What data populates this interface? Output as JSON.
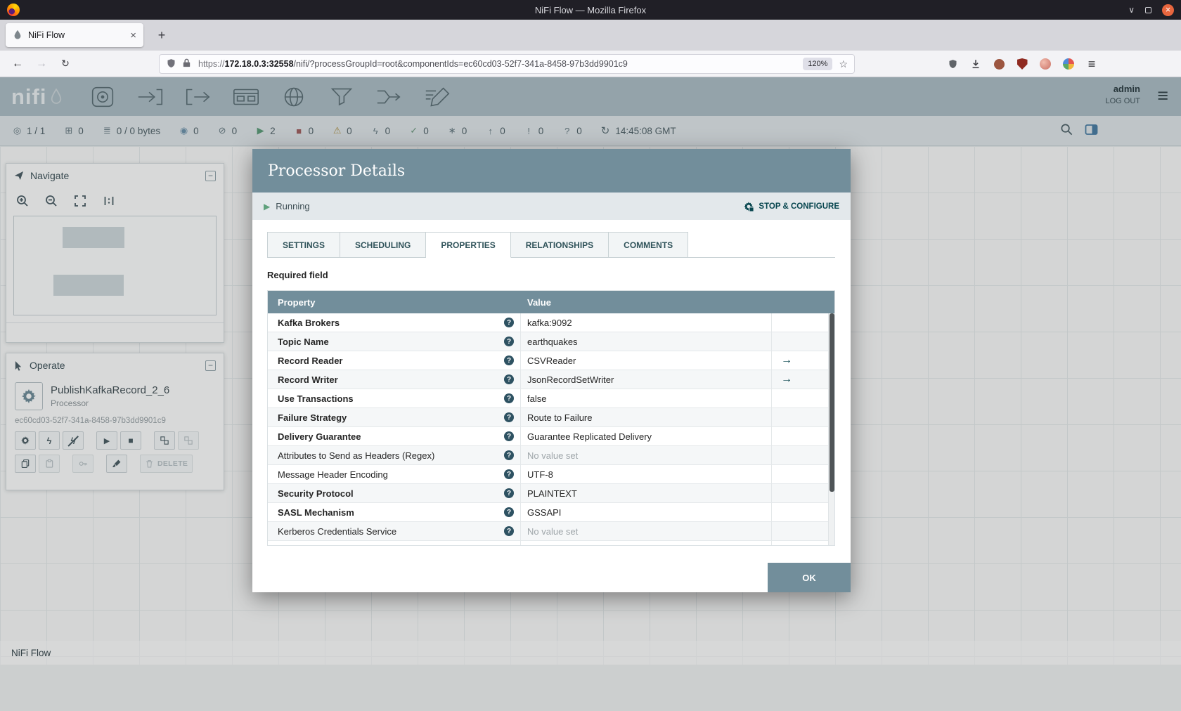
{
  "theme": {
    "dialog_header_bg": "#728e9b",
    "accent_dark_teal": "#004849",
    "status_strip_bg": "#e3e8eb",
    "running_green": "#5fa17c",
    "nifi_header_bg": "#adbec6",
    "ok_button_bg": "#728e9b"
  },
  "browser": {
    "window_title": "NiFi Flow — Mozilla Firefox",
    "tab": {
      "title": "NiFi Flow"
    },
    "url": {
      "protocol": "https://",
      "host": "172.18.0.3:32558",
      "path": "/nifi/?processGroupId=root&componentIds=ec60cd03-52f7-341a-8458-97b3dd9901c9"
    },
    "zoom_indicator": "120%"
  },
  "nifi": {
    "header": {
      "logo": "nifi",
      "user": "admin",
      "logout": "LOG OUT",
      "palette": [
        {
          "name": "processor"
        },
        {
          "name": "input-port"
        },
        {
          "name": "output-port"
        },
        {
          "name": "process-group"
        },
        {
          "name": "remote-process-group"
        },
        {
          "name": "funnel"
        },
        {
          "name": "template"
        },
        {
          "name": "label"
        }
      ]
    },
    "statusbar": {
      "items": [
        {
          "name": "clustered",
          "glyph": "◎",
          "count": "1 / 1"
        },
        {
          "name": "active-threads",
          "glyph": "⊞",
          "count": "0"
        },
        {
          "name": "queued",
          "glyph": "≣",
          "count": "0 / 0 bytes"
        },
        {
          "name": "transmitting",
          "glyph": "◉",
          "count": "0"
        },
        {
          "name": "not-transmitting",
          "glyph": "⊘",
          "count": "0"
        },
        {
          "name": "running",
          "glyph": "▶",
          "count": "2"
        },
        {
          "name": "stopped",
          "glyph": "■",
          "count": "0"
        },
        {
          "name": "invalid",
          "glyph": "⚠",
          "count": "0"
        },
        {
          "name": "disabled",
          "glyph": "ϟ",
          "count": "0"
        },
        {
          "name": "up-to-date",
          "glyph": "✓",
          "count": "0"
        },
        {
          "name": "locally-modified",
          "glyph": "∗",
          "count": "0"
        },
        {
          "name": "stale",
          "glyph": "↑",
          "count": "0"
        },
        {
          "name": "locally-modified-and-stale",
          "glyph": "!",
          "count": "0"
        },
        {
          "name": "sync-failure",
          "glyph": "?",
          "count": "0"
        }
      ],
      "last_refresh": "14:45:08 GMT"
    },
    "navigate": {
      "title": "Navigate"
    },
    "operate": {
      "title": "Operate",
      "component_name": "PublishKafkaRecord_2_6",
      "component_type": "Processor",
      "component_id": "ec60cd03-52f7-341a-8458-97b3dd9901c9",
      "delete_label": "DELETE"
    },
    "breadcrumb": "NiFi Flow"
  },
  "dialog": {
    "title": "Processor Details",
    "status_label": "Running",
    "stop_configure_label": "STOP & CONFIGURE",
    "tabs": [
      {
        "label": "SETTINGS",
        "active": false
      },
      {
        "label": "SCHEDULING",
        "active": false
      },
      {
        "label": "PROPERTIES",
        "active": true
      },
      {
        "label": "RELATIONSHIPS",
        "active": false
      },
      {
        "label": "COMMENTS",
        "active": false
      }
    ],
    "required_field_label": "Required field",
    "properties_table": {
      "headers": {
        "property": "Property",
        "value": "Value"
      },
      "rows": [
        {
          "property": "Kafka Brokers",
          "required": true,
          "value": "kafka:9092",
          "unset": false,
          "link": false
        },
        {
          "property": "Topic Name",
          "required": true,
          "value": "earthquakes",
          "unset": false,
          "link": false
        },
        {
          "property": "Record Reader",
          "required": true,
          "value": "CSVReader",
          "unset": false,
          "link": true
        },
        {
          "property": "Record Writer",
          "required": true,
          "value": "JsonRecordSetWriter",
          "unset": false,
          "link": true
        },
        {
          "property": "Use Transactions",
          "required": true,
          "value": "false",
          "unset": false,
          "link": false
        },
        {
          "property": "Failure Strategy",
          "required": true,
          "value": "Route to Failure",
          "unset": false,
          "link": false
        },
        {
          "property": "Delivery Guarantee",
          "required": true,
          "value": "Guarantee Replicated Delivery",
          "unset": false,
          "link": false
        },
        {
          "property": "Attributes to Send as Headers (Regex)",
          "required": false,
          "value": "No value set",
          "unset": true,
          "link": false
        },
        {
          "property": "Message Header Encoding",
          "required": false,
          "value": "UTF-8",
          "unset": false,
          "link": false
        },
        {
          "property": "Security Protocol",
          "required": true,
          "value": "PLAINTEXT",
          "unset": false,
          "link": false
        },
        {
          "property": "SASL Mechanism",
          "required": true,
          "value": "GSSAPI",
          "unset": false,
          "link": false
        },
        {
          "property": "Kerberos Credentials Service",
          "required": false,
          "value": "No value set",
          "unset": true,
          "link": false
        },
        {
          "property": "",
          "required": false,
          "value": "",
          "unset": false,
          "link": false
        }
      ]
    },
    "ok_label": "OK"
  }
}
